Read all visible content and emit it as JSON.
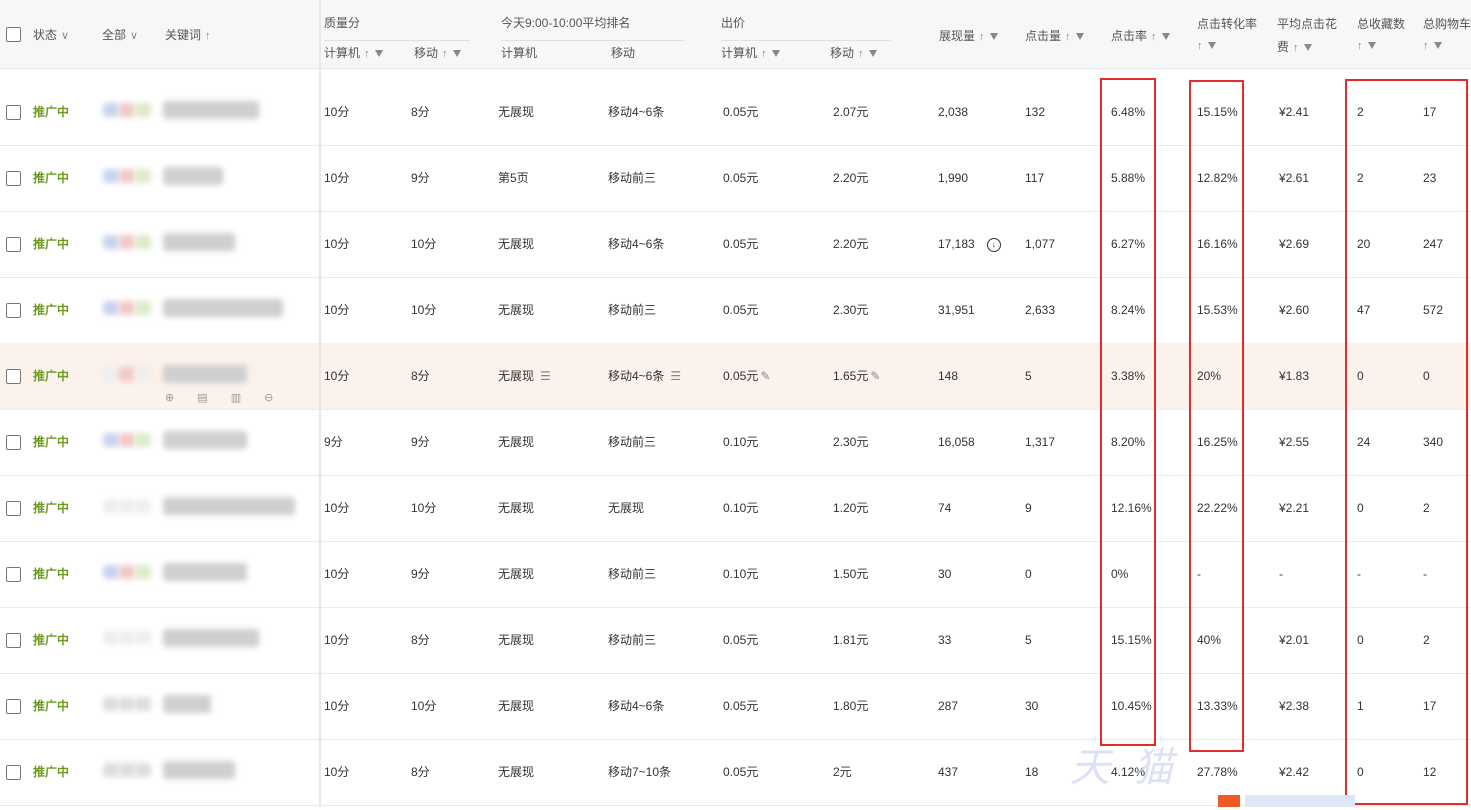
{
  "header": {
    "status": "状态",
    "all": "全部",
    "keyword": "关键词",
    "quality_score": "质量分",
    "rank_title": "今天9:00-10:00平均排名",
    "bid": "出价",
    "computer": "计算机",
    "mobile": "移动",
    "impressions": "展现量",
    "clicks": "点击量",
    "ctr": "点击率",
    "cvr": "点击转化率",
    "avg_cpc_line1": "平均点击花",
    "avg_cpc_line2": "费",
    "favorites": "总收藏数",
    "cart": "总购物车"
  },
  "rows": [
    {
      "status": "推广中",
      "qpc": "10分",
      "qmob": "8分",
      "rpc": "无展现",
      "rmob": "移动4~6条",
      "bpc": "0.05元",
      "bmob": "2.07元",
      "imp": "2,038",
      "clk": "132",
      "ctr": "6.48%",
      "cvr": "15.15%",
      "cpc": "¥2.41",
      "fav": "2",
      "cart": "17"
    },
    {
      "status": "推广中",
      "qpc": "10分",
      "qmob": "9分",
      "rpc": "第5页",
      "rmob": "移动前三",
      "bpc": "0.05元",
      "bmob": "2.20元",
      "imp": "1,990",
      "clk": "117",
      "ctr": "5.88%",
      "cvr": "12.82%",
      "cpc": "¥2.61",
      "fav": "2",
      "cart": "23"
    },
    {
      "status": "推广中",
      "qpc": "10分",
      "qmob": "10分",
      "rpc": "无展现",
      "rmob": "移动4~6条",
      "bpc": "0.05元",
      "bmob": "2.20元",
      "imp": "17,183",
      "clk": "1,077",
      "ctr": "6.27%",
      "cvr": "16.16%",
      "cpc": "¥2.69",
      "fav": "20",
      "cart": "247"
    },
    {
      "status": "推广中",
      "qpc": "10分",
      "qmob": "10分",
      "rpc": "无展现",
      "rmob": "移动前三",
      "bpc": "0.05元",
      "bmob": "2.30元",
      "imp": "31,951",
      "clk": "2,633",
      "ctr": "8.24%",
      "cvr": "15.53%",
      "cpc": "¥2.60",
      "fav": "47",
      "cart": "572"
    },
    {
      "status": "推广中",
      "qpc": "10分",
      "qmob": "8分",
      "rpc": "无展现",
      "rmob": "移动4~6条",
      "bpc": "0.05元",
      "bmob": "1.65元",
      "imp": "148",
      "clk": "5",
      "ctr": "3.38%",
      "cvr": "20%",
      "cpc": "¥1.83",
      "fav": "0",
      "cart": "0"
    },
    {
      "status": "推广中",
      "qpc": "9分",
      "qmob": "9分",
      "rpc": "无展现",
      "rmob": "移动前三",
      "bpc": "0.10元",
      "bmob": "2.30元",
      "imp": "16,058",
      "clk": "1,317",
      "ctr": "8.20%",
      "cvr": "16.25%",
      "cpc": "¥2.55",
      "fav": "24",
      "cart": "340"
    },
    {
      "status": "推广中",
      "qpc": "10分",
      "qmob": "10分",
      "rpc": "无展现",
      "rmob": "无展现",
      "bpc": "0.10元",
      "bmob": "1.20元",
      "imp": "74",
      "clk": "9",
      "ctr": "12.16%",
      "cvr": "22.22%",
      "cpc": "¥2.21",
      "fav": "0",
      "cart": "2"
    },
    {
      "status": "推广中",
      "qpc": "10分",
      "qmob": "9分",
      "rpc": "无展现",
      "rmob": "移动前三",
      "bpc": "0.10元",
      "bmob": "1.50元",
      "imp": "30",
      "clk": "0",
      "ctr": "0%",
      "cvr": "-",
      "cpc": "-",
      "fav": "-",
      "cart": "-"
    },
    {
      "status": "推广中",
      "qpc": "10分",
      "qmob": "8分",
      "rpc": "无展现",
      "rmob": "移动前三",
      "bpc": "0.05元",
      "bmob": "1.81元",
      "imp": "33",
      "clk": "5",
      "ctr": "15.15%",
      "cvr": "40%",
      "cpc": "¥2.01",
      "fav": "0",
      "cart": "2"
    },
    {
      "status": "推广中",
      "qpc": "10分",
      "qmob": "10分",
      "rpc": "无展现",
      "rmob": "移动4~6条",
      "bpc": "0.05元",
      "bmob": "1.80元",
      "imp": "287",
      "clk": "30",
      "ctr": "10.45%",
      "cvr": "13.33%",
      "cpc": "¥2.38",
      "fav": "1",
      "cart": "17"
    },
    {
      "status": "推广中",
      "qpc": "10分",
      "qmob": "8分",
      "rpc": "无展现",
      "rmob": "移动7~10条",
      "bpc": "0.05元",
      "bmob": "2元",
      "imp": "437",
      "clk": "18",
      "ctr": "4.12%",
      "cvr": "27.78%",
      "cpc": "¥2.42",
      "fav": "0",
      "cart": "12"
    }
  ],
  "colors": {
    "status_green": "#6b9c1f",
    "highlight_box": "#e52b2b",
    "row_highlight": "#fbf2eb"
  }
}
